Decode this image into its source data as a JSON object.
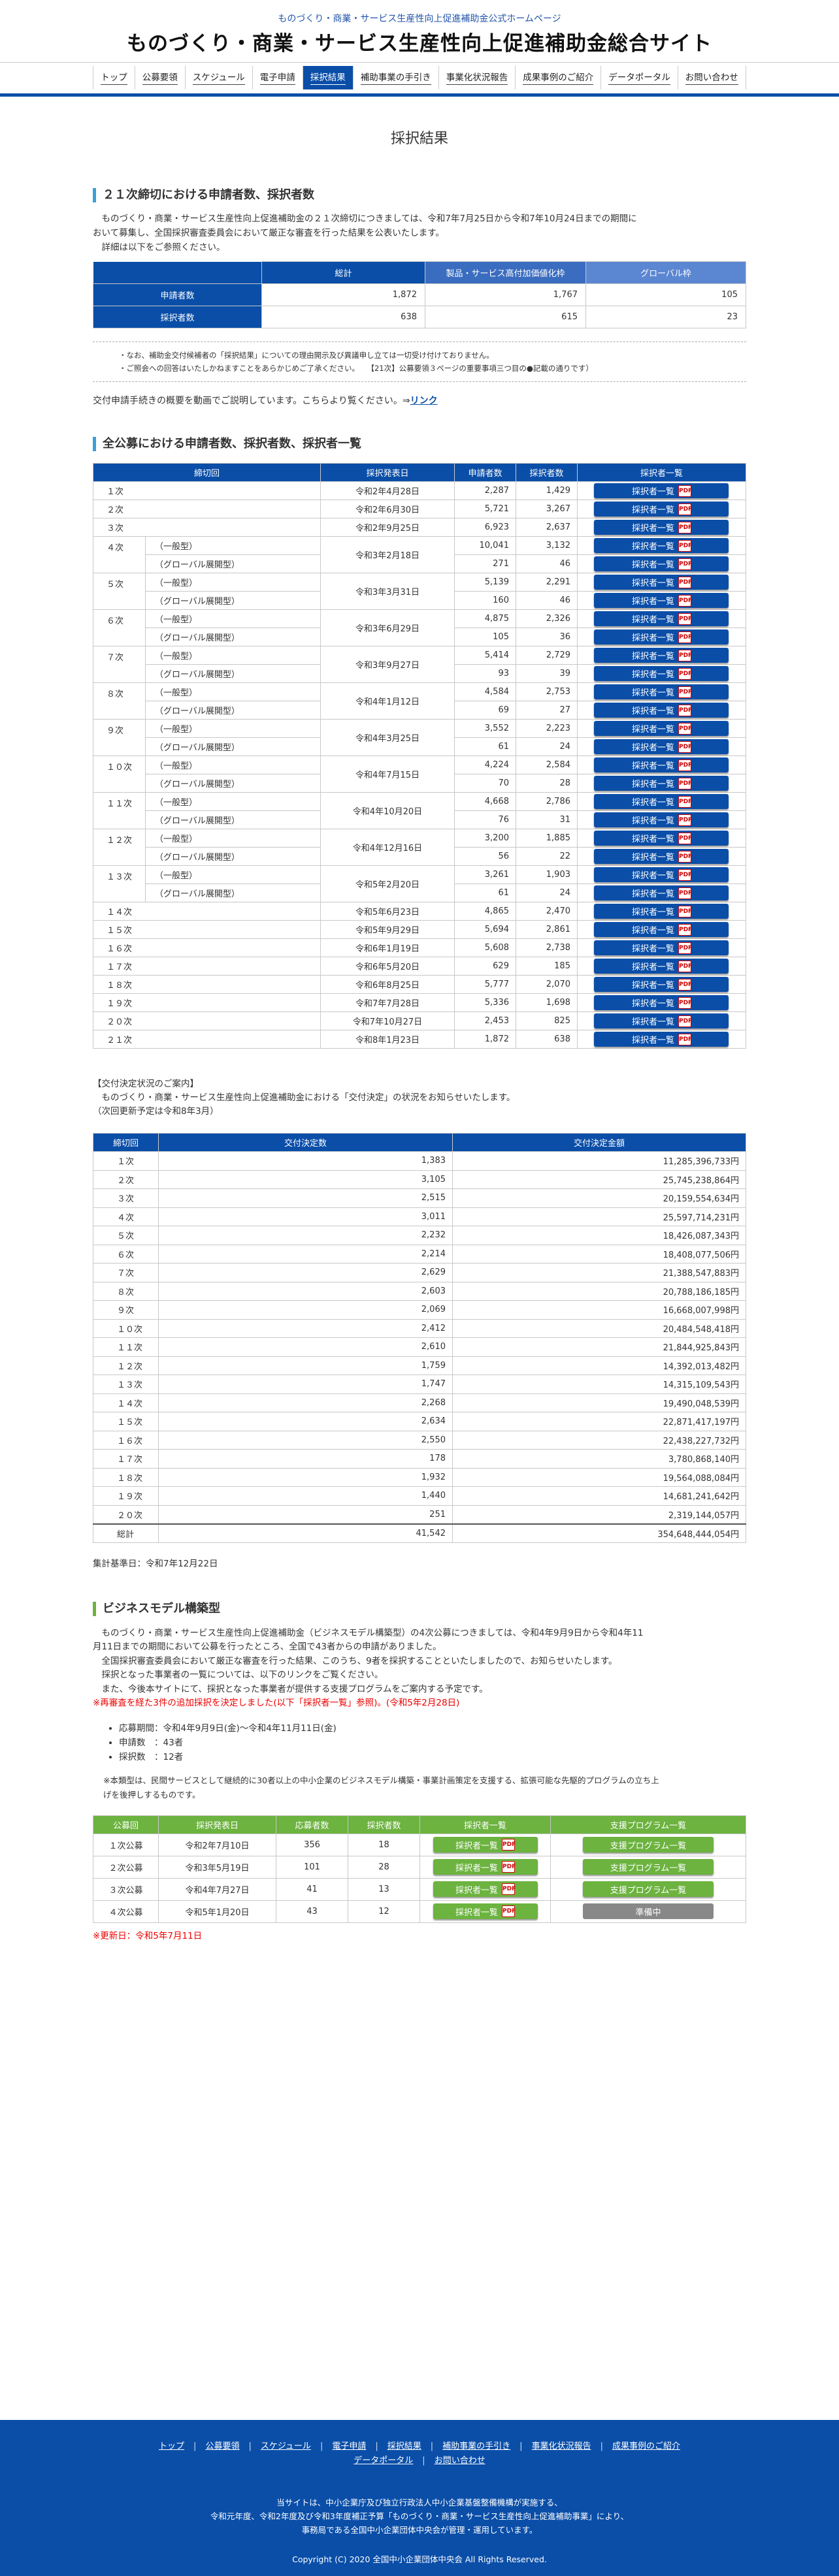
{
  "header": {
    "tagline": "ものづくり・商業・サービス生産性向上促進補助金公式ホームページ",
    "title": "ものづくり・商業・サービス生産性向上促進補助金総合サイト"
  },
  "nav": [
    "トップ",
    "公募要領",
    "スケジュール",
    "電子申請",
    "採択結果",
    "補助事業の手引き",
    "事業化状況報告",
    "成果事例のご紹介",
    "データポータル",
    "お問い合わせ"
  ],
  "page_title": "採択結果",
  "sec21": {
    "title": "２１次締切における申請者数、採択者数",
    "p1": "ものづくり・商業・サービス生産性向上促進補助金の２１次締切につきましては、令和7年7月25日から令和7年10月24日までの期間に",
    "p2": "おいて募集し、全国採択審査委員会において厳正な審査を行った結果を公表いたします。",
    "p3": "詳細は以下をご参照ください。",
    "headers": [
      "総計",
      "製品・サービス高付加価値化枠",
      "グローバル枠"
    ],
    "rows": [
      {
        "label": "申請者数",
        "vals": [
          "1,872",
          "1,767",
          "105"
        ]
      },
      {
        "label": "採択者数",
        "vals": [
          "638",
          "615",
          "23"
        ]
      }
    ],
    "note1": "・なお、補助金交付候補者の「採択結果」についての理由開示及び異議申し立ては一切受け付けておりません。",
    "note2": "・ご照会への回答はいたしかねますことをあらかじめご了承ください。　　【21次】公募要領３ページの重要事項三つ目の●記載の通りです）",
    "video_text": "交付申請手続きの概要を動画でご説明しています。こちらより覧ください。⇒",
    "video_link": "リンク"
  },
  "list": {
    "title": "全公募における申請者数、採択者数、採択者一覧",
    "headers": [
      "締切回",
      "採択発表日",
      "申請者数",
      "採択者数",
      "採択者一覧"
    ],
    "btn": "採択者一覧",
    "pdf": "PDF",
    "rows": [
      {
        "round": "１次",
        "date": "令和2年4月28日",
        "app": "2,287",
        "adopt": "1,429"
      },
      {
        "round": "２次",
        "date": "令和2年6月30日",
        "app": "5,721",
        "adopt": "3,267"
      },
      {
        "round": "３次",
        "date": "令和2年9月25日",
        "app": "6,923",
        "adopt": "2,637"
      },
      {
        "round": "４次",
        "date": "令和3年2月18日",
        "sub": [
          {
            "t": "（一般型）",
            "app": "10,041",
            "adopt": "3,132"
          },
          {
            "t": "（グローバル展開型）",
            "app": "271",
            "adopt": "46"
          }
        ]
      },
      {
        "round": "５次",
        "date": "令和3年3月31日",
        "sub": [
          {
            "t": "（一般型）",
            "app": "5,139",
            "adopt": "2,291"
          },
          {
            "t": "（グローバル展開型）",
            "app": "160",
            "adopt": "46"
          }
        ]
      },
      {
        "round": "６次",
        "date": "令和3年6月29日",
        "sub": [
          {
            "t": "（一般型）",
            "app": "4,875",
            "adopt": "2,326"
          },
          {
            "t": "（グローバル展開型）",
            "app": "105",
            "adopt": "36"
          }
        ]
      },
      {
        "round": "７次",
        "date": "令和3年9月27日",
        "sub": [
          {
            "t": "（一般型）",
            "app": "5,414",
            "adopt": "2,729"
          },
          {
            "t": "（グローバル展開型）",
            "app": "93",
            "adopt": "39"
          }
        ]
      },
      {
        "round": "８次",
        "date": "令和4年1月12日",
        "sub": [
          {
            "t": "（一般型）",
            "app": "4,584",
            "adopt": "2,753"
          },
          {
            "t": "（グローバル展開型）",
            "app": "69",
            "adopt": "27"
          }
        ]
      },
      {
        "round": "９次",
        "date": "令和4年3月25日",
        "sub": [
          {
            "t": "（一般型）",
            "app": "3,552",
            "adopt": "2,223"
          },
          {
            "t": "（グローバル展開型）",
            "app": "61",
            "adopt": "24"
          }
        ]
      },
      {
        "round": "１０次",
        "date": "令和4年7月15日",
        "sub": [
          {
            "t": "（一般型）",
            "app": "4,224",
            "adopt": "2,584"
          },
          {
            "t": "（グローバル展開型）",
            "app": "70",
            "adopt": "28"
          }
        ]
      },
      {
        "round": "１１次",
        "date": "令和4年10月20日",
        "sub": [
          {
            "t": "（一般型）",
            "app": "4,668",
            "adopt": "2,786"
          },
          {
            "t": "（グローバル展開型）",
            "app": "76",
            "adopt": "31"
          }
        ]
      },
      {
        "round": "１２次",
        "date": "令和4年12月16日",
        "sub": [
          {
            "t": "（一般型）",
            "app": "3,200",
            "adopt": "1,885"
          },
          {
            "t": "（グローバル展開型）",
            "app": "56",
            "adopt": "22"
          }
        ]
      },
      {
        "round": "１３次",
        "date": "令和5年2月20日",
        "sub": [
          {
            "t": "（一般型）",
            "app": "3,261",
            "adopt": "1,903"
          },
          {
            "t": "（グローバル展開型）",
            "app": "61",
            "adopt": "24"
          }
        ]
      },
      {
        "round": "１４次",
        "date": "令和5年6月23日",
        "app": "4,865",
        "adopt": "2,470"
      },
      {
        "round": "１５次",
        "date": "令和5年9月29日",
        "app": "5,694",
        "adopt": "2,861"
      },
      {
        "round": "１６次",
        "date": "令和6年1月19日",
        "app": "5,608",
        "adopt": "2,738"
      },
      {
        "round": "１７次",
        "date": "令和6年5月20日",
        "app": "629",
        "adopt": "185"
      },
      {
        "round": "１８次",
        "date": "令和6年8月25日",
        "app": "5,777",
        "adopt": "2,070"
      },
      {
        "round": "１９次",
        "date": "令和7年7月28日",
        "app": "5,336",
        "adopt": "1,698"
      },
      {
        "round": "２０次",
        "date": "令和7年10月27日",
        "app": "2,453",
        "adopt": "825"
      },
      {
        "round": "２１次",
        "date": "令和8年1月23日",
        "app": "1,872",
        "adopt": "638"
      }
    ]
  },
  "koufu": {
    "l1": "【交付決定状況のご案内】",
    "l2": "ものづくり・商業・サービス生産性向上促進補助金における「交付決定」の状況をお知らせいたします。",
    "l3": "（次回更新予定は令和8年3月）",
    "headers": [
      "締切回",
      "交付決定数",
      "交付決定金額"
    ],
    "rows": [
      [
        "１次",
        "1,383",
        "11,285,396,733円"
      ],
      [
        "２次",
        "3,105",
        "25,745,238,864円"
      ],
      [
        "３次",
        "2,515",
        "20,159,554,634円"
      ],
      [
        "４次",
        "3,011",
        "25,597,714,231円"
      ],
      [
        "５次",
        "2,232",
        "18,426,087,343円"
      ],
      [
        "６次",
        "2,214",
        "18,408,077,506円"
      ],
      [
        "７次",
        "2,629",
        "21,388,547,883円"
      ],
      [
        "８次",
        "2,603",
        "20,788,186,185円"
      ],
      [
        "９次",
        "2,069",
        "16,668,007,998円"
      ],
      [
        "１０次",
        "2,412",
        "20,484,548,418円"
      ],
      [
        "１１次",
        "2,610",
        "21,844,925,843円"
      ],
      [
        "１２次",
        "1,759",
        "14,392,013,482円"
      ],
      [
        "１３次",
        "1,747",
        "14,315,109,543円"
      ],
      [
        "１４次",
        "2,268",
        "19,490,048,539円"
      ],
      [
        "１５次",
        "2,634",
        "22,871,417,197円"
      ],
      [
        "１６次",
        "2,550",
        "22,438,227,732円"
      ],
      [
        "１７次",
        "178",
        "3,780,868,140円"
      ],
      [
        "１８次",
        "1,932",
        "19,564,088,084円"
      ],
      [
        "１９次",
        "1,440",
        "14,681,241,642円"
      ],
      [
        "２０次",
        "251",
        "2,319,144,057円"
      ]
    ],
    "total": [
      "総計",
      "41,542",
      "354,648,444,054円"
    ],
    "date": "集計基準日：令和7年12月22日"
  },
  "biz": {
    "title": "ビジネスモデル構築型",
    "p1": "ものづくり・商業・サービス生産性向上促進補助金（ビジネスモデル構築型）の4次公募につきましては、令和4年9月9日から令和4年11",
    "p2": "月11日までの期間において公募を行ったところ、全国で43者からの申請がありました。",
    "p3": "全国採択審査委員会において厳正な審査を行った結果、このうち、9者を採択することといたしましたので、お知らせいたします。",
    "p4": "採択となった事業者の一覧については、以下のリンクをご覧ください。",
    "p5": "また、今後本サイトにて、採択となった事業者が提供する支援プログラムをご案内する予定です。",
    "red1": "※再審査を経た3件の追加採択を決定しました(以下「採択者一覧」参照)。(令和5年2月28日)",
    "b1": "応募期間：令和4年9月9日(金)〜令和4年11月11日(金)",
    "b2": "申請数　：43者",
    "b3": "採択数　：12者",
    "n1": "※本類型は、民間サービスとして継続的に30者以上の中小企業のビジネスモデル構築・事業計画策定を支援する、拡張可能な先駆的プログラムの立ち上",
    "n2": "げを後押しするものです。",
    "headers": [
      "公募回",
      "採択発表日",
      "応募者数",
      "採択者数",
      "採択者一覧",
      "支援プログラム一覧"
    ],
    "btn": "採択者一覧",
    "prog": "支援プログラム一覧",
    "pending": "準備中",
    "rows": [
      [
        "１次公募",
        "令和2年7月10日",
        "356",
        "18"
      ],
      [
        "２次公募",
        "令和3年5月19日",
        "101",
        "28"
      ],
      [
        "３次公募",
        "令和4年7月27日",
        "41",
        "13"
      ],
      [
        "４次公募",
        "令和5年1月20日",
        "43",
        "12"
      ]
    ],
    "updated": "※更新日：令和5年7月11日"
  },
  "footer": {
    "nav": [
      "トップ",
      "公募要領",
      "スケジュール",
      "電子申請",
      "採択結果",
      "補助事業の手引き",
      "事業化状況報告",
      "成果事例のご紹介",
      "データポータル",
      "お問い合わせ"
    ],
    "i1": "当サイトは、中小企業庁及び独立行政法人中小企業基盤整備機構が実施する、",
    "i2": "令和元年度、令和2年度及び令和3年度補正予算「ものづくり・商業・サービス生産性向上促進補助事業」により、",
    "i3": "事務局である全国中小企業団体中央会が管理・運用しています。",
    "copy": "Copyright (C) 2020 全国中小企業団体中央会 All Rights Reserved."
  }
}
